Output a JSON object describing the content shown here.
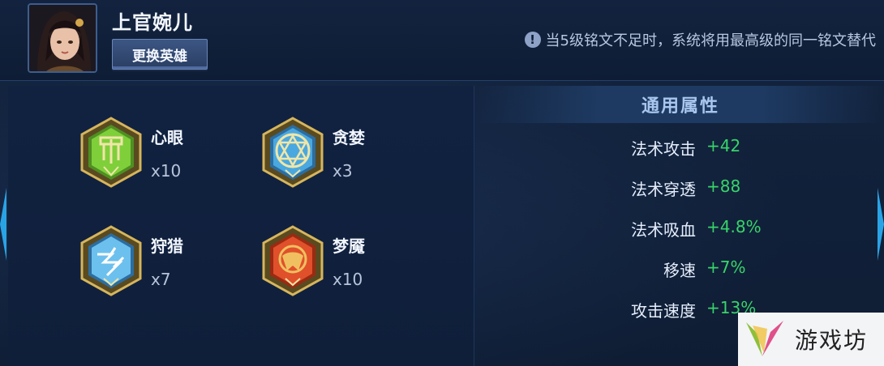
{
  "header": {
    "hero_name": "上官婉儿",
    "change_hero_label": "更换英雄",
    "notice_icon_symbol": "!",
    "notice_text": "当5级铭文不足时，系统将用最高级的同一铭文替代"
  },
  "runes": [
    {
      "name": "心眼",
      "count": "x10",
      "icon": "green-rune-icon",
      "color": "#7fcf3a"
    },
    {
      "name": "贪婪",
      "count": "x3",
      "icon": "blue-rune-icon",
      "color": "#4aa8e0"
    },
    {
      "name": "狩猎",
      "count": "x7",
      "icon": "blue-rune-icon",
      "color": "#4aa8e0"
    },
    {
      "name": "梦魇",
      "count": "x10",
      "icon": "red-rune-icon",
      "color": "#e0502a"
    }
  ],
  "stats": {
    "title": "通用属性",
    "rows": [
      {
        "label": "法术攻击",
        "value": "+42"
      },
      {
        "label": "法术穿透",
        "value": "+88"
      },
      {
        "label": "法术吸血",
        "value": "+4.8%"
      },
      {
        "label": "移速",
        "value": "+7%"
      },
      {
        "label": "攻击速度",
        "value": "+13%"
      }
    ]
  },
  "watermark": {
    "text": "游戏坊"
  }
}
